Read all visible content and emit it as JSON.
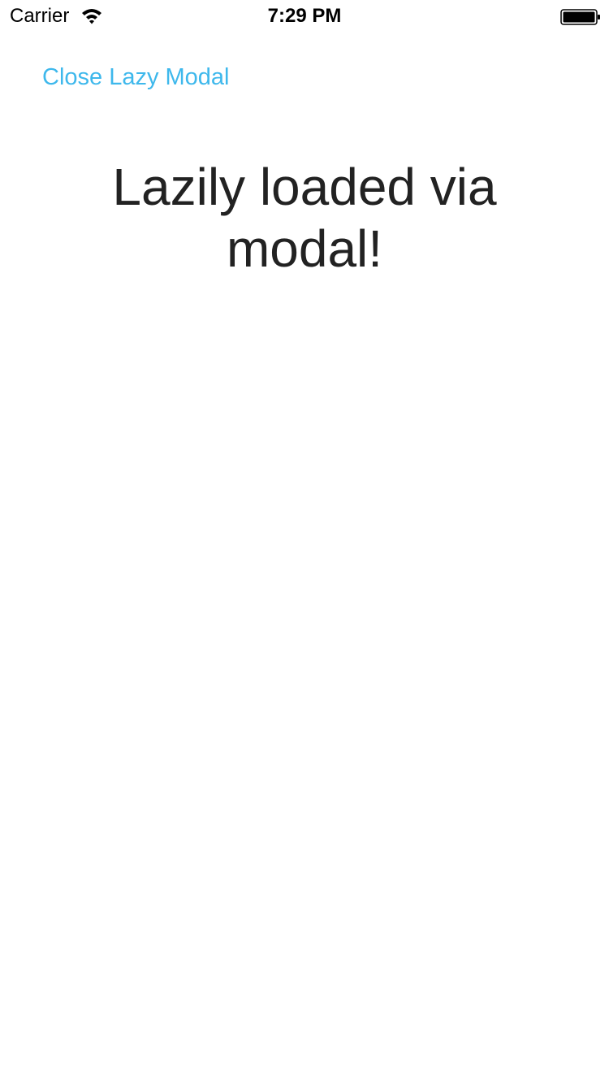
{
  "status_bar": {
    "carrier": "Carrier",
    "time": "7:29 PM",
    "icons": [
      "wifi-icon",
      "battery-icon"
    ]
  },
  "modal": {
    "close_label": "Close Lazy Modal",
    "heading": "Lazily loaded via modal!"
  },
  "colors": {
    "link": "#3eb8ec",
    "text": "#222222",
    "background": "#ffffff"
  }
}
